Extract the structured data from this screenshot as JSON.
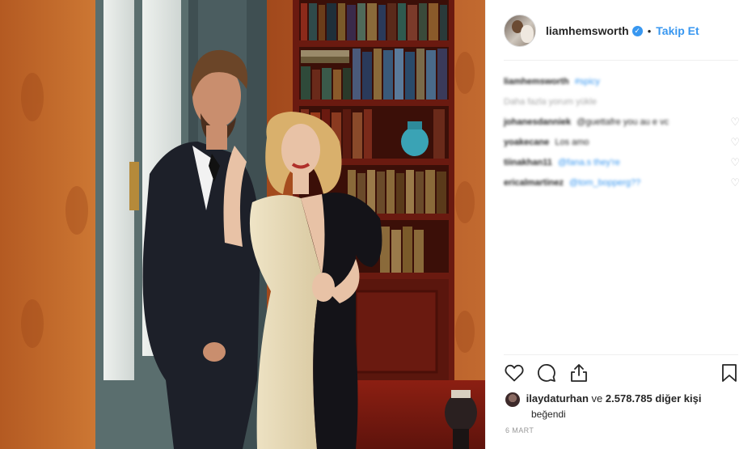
{
  "post": {
    "username": "liamhemsworth",
    "follow_label": "Takip Et",
    "separator": "•",
    "verified_icon": "check-icon"
  },
  "comments": [
    {
      "user": "liamhemsworth",
      "text": "#spicy",
      "blurred": true
    },
    {
      "more": "Daha fazla yorum yükle",
      "blurred": true
    },
    {
      "user": "johanesdanniek",
      "text": "@guettafre you au e vc",
      "blurred": true
    },
    {
      "user": "yoakecane",
      "text": "Los amo",
      "blurred": true
    },
    {
      "user": "tiinakhan11",
      "text": "@fana.s they're",
      "blurred": true
    },
    {
      "user": "ericalmartinez",
      "text": "@tom_bopperg??",
      "blurred": true
    }
  ],
  "likes": {
    "liker": "ilaydaturhan",
    "connector": "ve",
    "count": "2.578.785",
    "suffix": "diğer kişi",
    "liked_label": "beğendi"
  },
  "date": "6 MART",
  "colors": {
    "link": "#3897f0",
    "text": "#262626",
    "muted": "#999999",
    "divider": "#efefef"
  }
}
